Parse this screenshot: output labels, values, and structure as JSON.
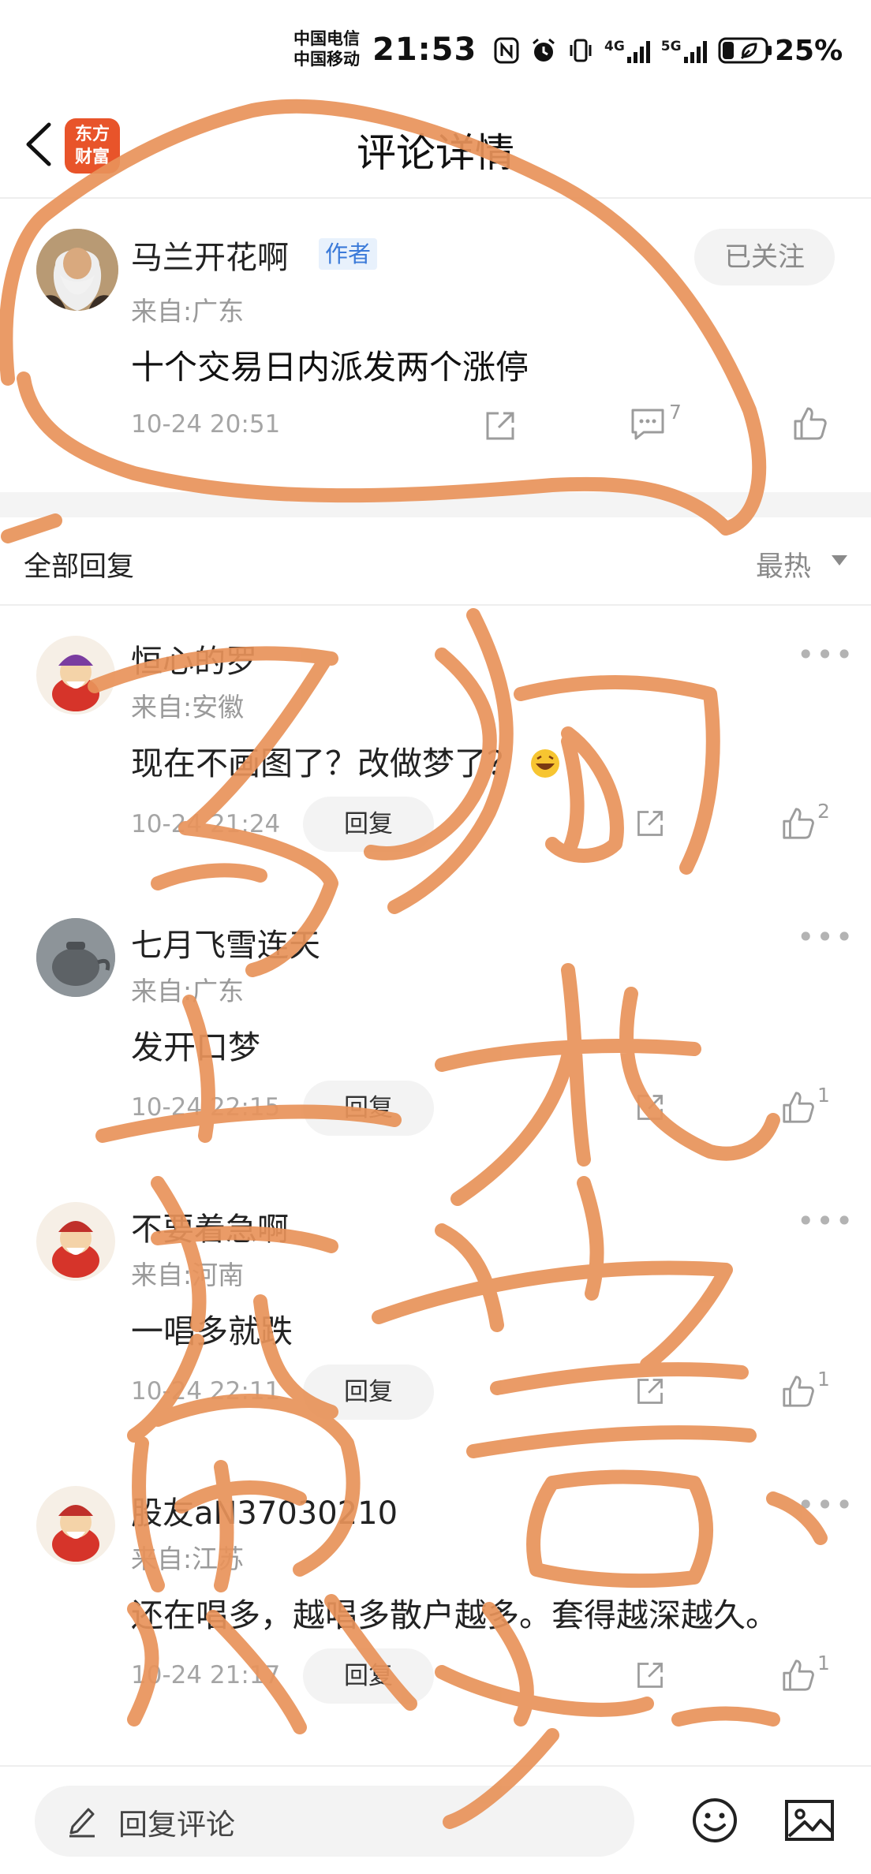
{
  "status_bar": {
    "carrier_1": "中国电信",
    "carrier_2": "中国移动",
    "time": "21:53",
    "network_1": "4G",
    "network_2": "5G",
    "battery": "25%"
  },
  "header": {
    "brand_line_1": "东方",
    "brand_line_2": "财富",
    "title": "评论详情"
  },
  "main_comment": {
    "author": "马兰开花啊",
    "author_tag": "作者",
    "follow_label": "已关注",
    "location": "来自:广东",
    "text": "十个交易日内派发两个涨停",
    "time": "10-24 20:51",
    "comment_count": "7"
  },
  "replies_header": {
    "title": "全部回复",
    "sort": "最热"
  },
  "replies": [
    {
      "name": "恒心的罗",
      "location": "来自:安徽",
      "text": "现在不画图了？改做梦了？",
      "time": "10-24 21:24",
      "reply_label": "回复",
      "likes": "2",
      "avatar_color": "#f6efe6"
    },
    {
      "name": "七月飞雪连天",
      "location": "来自:广东",
      "text": "发开口梦",
      "time": "10-24 22:15",
      "reply_label": "回复",
      "likes": "1",
      "avatar_color": "#9aa1a6"
    },
    {
      "name": "不要着急啊",
      "location": "来自:河南",
      "text": "一唱多就跌",
      "time": "10-24 22:11",
      "reply_label": "回复",
      "likes": "1",
      "avatar_color": "#f6efe6"
    },
    {
      "name": "股友aN37030210",
      "location": "来自:江苏",
      "text": "还在唱多，越唱多散户越多。套得越深越久。",
      "time": "10-24 21:17",
      "reply_label": "回复",
      "likes": "1",
      "avatar_color": "#f6efe6"
    }
  ],
  "bottom_bar": {
    "placeholder": "回复评论"
  },
  "overlay": {
    "ink_color": "#e8935a"
  }
}
